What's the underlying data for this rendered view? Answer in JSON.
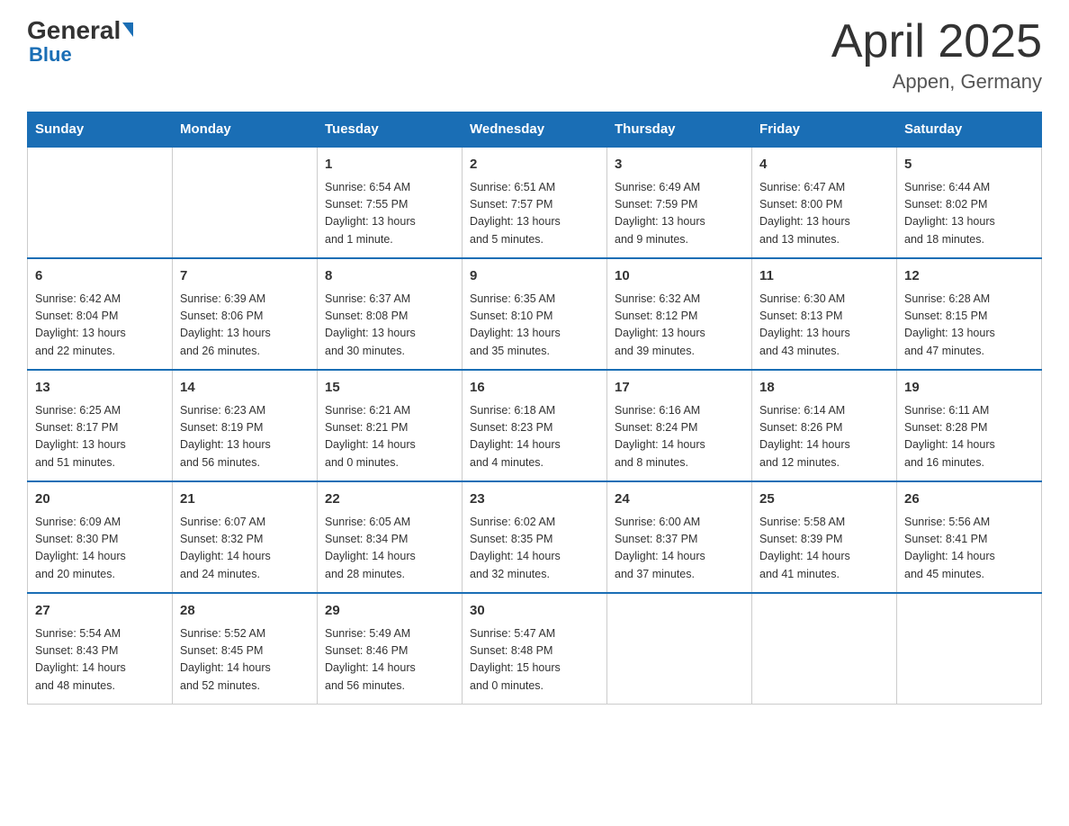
{
  "header": {
    "logo": {
      "general": "General",
      "blue": "Blue"
    },
    "title": "April 2025",
    "subtitle": "Appen, Germany"
  },
  "weekdays": [
    "Sunday",
    "Monday",
    "Tuesday",
    "Wednesday",
    "Thursday",
    "Friday",
    "Saturday"
  ],
  "weeks": [
    [
      {
        "day": "",
        "info": ""
      },
      {
        "day": "",
        "info": ""
      },
      {
        "day": "1",
        "info": "Sunrise: 6:54 AM\nSunset: 7:55 PM\nDaylight: 13 hours\nand 1 minute."
      },
      {
        "day": "2",
        "info": "Sunrise: 6:51 AM\nSunset: 7:57 PM\nDaylight: 13 hours\nand 5 minutes."
      },
      {
        "day": "3",
        "info": "Sunrise: 6:49 AM\nSunset: 7:59 PM\nDaylight: 13 hours\nand 9 minutes."
      },
      {
        "day": "4",
        "info": "Sunrise: 6:47 AM\nSunset: 8:00 PM\nDaylight: 13 hours\nand 13 minutes."
      },
      {
        "day": "5",
        "info": "Sunrise: 6:44 AM\nSunset: 8:02 PM\nDaylight: 13 hours\nand 18 minutes."
      }
    ],
    [
      {
        "day": "6",
        "info": "Sunrise: 6:42 AM\nSunset: 8:04 PM\nDaylight: 13 hours\nand 22 minutes."
      },
      {
        "day": "7",
        "info": "Sunrise: 6:39 AM\nSunset: 8:06 PM\nDaylight: 13 hours\nand 26 minutes."
      },
      {
        "day": "8",
        "info": "Sunrise: 6:37 AM\nSunset: 8:08 PM\nDaylight: 13 hours\nand 30 minutes."
      },
      {
        "day": "9",
        "info": "Sunrise: 6:35 AM\nSunset: 8:10 PM\nDaylight: 13 hours\nand 35 minutes."
      },
      {
        "day": "10",
        "info": "Sunrise: 6:32 AM\nSunset: 8:12 PM\nDaylight: 13 hours\nand 39 minutes."
      },
      {
        "day": "11",
        "info": "Sunrise: 6:30 AM\nSunset: 8:13 PM\nDaylight: 13 hours\nand 43 minutes."
      },
      {
        "day": "12",
        "info": "Sunrise: 6:28 AM\nSunset: 8:15 PM\nDaylight: 13 hours\nand 47 minutes."
      }
    ],
    [
      {
        "day": "13",
        "info": "Sunrise: 6:25 AM\nSunset: 8:17 PM\nDaylight: 13 hours\nand 51 minutes."
      },
      {
        "day": "14",
        "info": "Sunrise: 6:23 AM\nSunset: 8:19 PM\nDaylight: 13 hours\nand 56 minutes."
      },
      {
        "day": "15",
        "info": "Sunrise: 6:21 AM\nSunset: 8:21 PM\nDaylight: 14 hours\nand 0 minutes."
      },
      {
        "day": "16",
        "info": "Sunrise: 6:18 AM\nSunset: 8:23 PM\nDaylight: 14 hours\nand 4 minutes."
      },
      {
        "day": "17",
        "info": "Sunrise: 6:16 AM\nSunset: 8:24 PM\nDaylight: 14 hours\nand 8 minutes."
      },
      {
        "day": "18",
        "info": "Sunrise: 6:14 AM\nSunset: 8:26 PM\nDaylight: 14 hours\nand 12 minutes."
      },
      {
        "day": "19",
        "info": "Sunrise: 6:11 AM\nSunset: 8:28 PM\nDaylight: 14 hours\nand 16 minutes."
      }
    ],
    [
      {
        "day": "20",
        "info": "Sunrise: 6:09 AM\nSunset: 8:30 PM\nDaylight: 14 hours\nand 20 minutes."
      },
      {
        "day": "21",
        "info": "Sunrise: 6:07 AM\nSunset: 8:32 PM\nDaylight: 14 hours\nand 24 minutes."
      },
      {
        "day": "22",
        "info": "Sunrise: 6:05 AM\nSunset: 8:34 PM\nDaylight: 14 hours\nand 28 minutes."
      },
      {
        "day": "23",
        "info": "Sunrise: 6:02 AM\nSunset: 8:35 PM\nDaylight: 14 hours\nand 32 minutes."
      },
      {
        "day": "24",
        "info": "Sunrise: 6:00 AM\nSunset: 8:37 PM\nDaylight: 14 hours\nand 37 minutes."
      },
      {
        "day": "25",
        "info": "Sunrise: 5:58 AM\nSunset: 8:39 PM\nDaylight: 14 hours\nand 41 minutes."
      },
      {
        "day": "26",
        "info": "Sunrise: 5:56 AM\nSunset: 8:41 PM\nDaylight: 14 hours\nand 45 minutes."
      }
    ],
    [
      {
        "day": "27",
        "info": "Sunrise: 5:54 AM\nSunset: 8:43 PM\nDaylight: 14 hours\nand 48 minutes."
      },
      {
        "day": "28",
        "info": "Sunrise: 5:52 AM\nSunset: 8:45 PM\nDaylight: 14 hours\nand 52 minutes."
      },
      {
        "day": "29",
        "info": "Sunrise: 5:49 AM\nSunset: 8:46 PM\nDaylight: 14 hours\nand 56 minutes."
      },
      {
        "day": "30",
        "info": "Sunrise: 5:47 AM\nSunset: 8:48 PM\nDaylight: 15 hours\nand 0 minutes."
      },
      {
        "day": "",
        "info": ""
      },
      {
        "day": "",
        "info": ""
      },
      {
        "day": "",
        "info": ""
      }
    ]
  ]
}
